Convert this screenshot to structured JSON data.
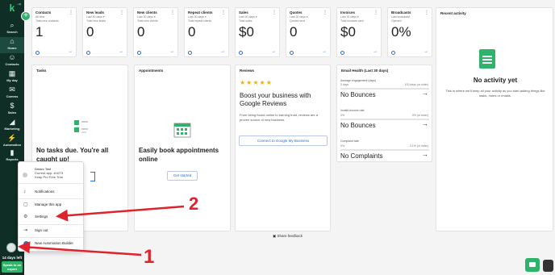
{
  "sidebar": {
    "logo": "k",
    "collapse_icon": "collapse-icon",
    "items": [
      {
        "label": "Search",
        "icon": "⌕"
      },
      {
        "label": "Home",
        "icon": "⌂"
      },
      {
        "label": "Contacts",
        "icon": "☺"
      },
      {
        "label": "My day",
        "icon": "▦"
      },
      {
        "label": "Comms",
        "icon": "✉"
      },
      {
        "label": "Sales",
        "icon": "$"
      },
      {
        "label": "Marketing",
        "icon": "◢"
      },
      {
        "label": "Automation",
        "icon": "⚡"
      },
      {
        "label": "Reports",
        "icon": "▮"
      }
    ],
    "trial_days": "14 days left",
    "expert_btn": "Speak to an expert"
  },
  "stats": [
    {
      "title": "Contacts",
      "sub": "All time",
      "sub2": "Total new contacts",
      "value": "1"
    },
    {
      "title": "New leads",
      "sub": "Last 30 days ▾",
      "sub2": "Total new leads",
      "value": "0"
    },
    {
      "title": "New clients",
      "sub": "Last 30 days ▾",
      "sub2": "Total new clients",
      "value": "0"
    },
    {
      "title": "Repeat clients",
      "sub": "Last 30 days ▾",
      "sub2": "Total repeat clients",
      "value": "0"
    },
    {
      "title": "Sales",
      "sub": "Last 30 days ▾",
      "sub2": "Total sales",
      "value": "$0"
    },
    {
      "title": "Quotes",
      "sub": "Last 30 days ▾",
      "sub2": "Quotes sent",
      "value": "0"
    },
    {
      "title": "Invoices",
      "sub": "Last 30 days ▾",
      "sub2": "Total invoices sent",
      "value": "$0"
    },
    {
      "title": "Broadcasts",
      "sub": "Last broadcast",
      "sub2": "Opened",
      "value": "0%"
    }
  ],
  "recent": {
    "title": "Recent activity",
    "empty": "No activity yet",
    "desc": "This is where we'll keep all your activity as you start adding things like tasks, notes or emails."
  },
  "tasks": {
    "title": "Tasks",
    "heading": "No tasks due. You're all caught up!"
  },
  "appointments": {
    "title": "Appointments",
    "heading": "Easily book appointments online",
    "button": "Get started"
  },
  "reviews": {
    "title": "Reviews",
    "stars": "★★★★★",
    "heading": "Boost your business with Google Reviews",
    "desc": "From being found online to earning trust, reviews are a proven source of new business.",
    "button": "Connect to Google My Business"
  },
  "email_health": {
    "title": "Email Health (Last 30 days)",
    "rows": [
      {
        "label": "Average engagement (days)",
        "left": "0 days",
        "right": "100 days (or older)",
        "status": "No Bounces"
      },
      {
        "label": "Invalid bounce rate",
        "left": "0%",
        "right": "0% (or older)",
        "status": "No Bounces"
      },
      {
        "label": "Complaint rate",
        "left": "0%",
        "right": "0.1% (or older)",
        "status": "No Complaints"
      }
    ]
  },
  "feedback": "Share feedback",
  "popup": {
    "name": "Dmarc Test",
    "app": "Current app: zhl273",
    "trial": "Keap Pro Free Trial",
    "items": [
      {
        "label": "Notifications",
        "icon": "bell-icon",
        "glyph": "♪"
      },
      {
        "label": "Manage this app",
        "icon": "file-icon",
        "glyph": "▢"
      },
      {
        "label": "Settings",
        "icon": "gear-icon",
        "glyph": "⚙"
      },
      {
        "label": "Sign out",
        "icon": "signout-icon",
        "glyph": "⇥"
      },
      {
        "label": "New Automation Builder",
        "icon": "toggle-icon",
        "glyph": ""
      }
    ]
  },
  "annotations": {
    "one": "1",
    "two": "2",
    "color": "#e0222b"
  },
  "colors": {
    "sidebar": "#0f2e26",
    "accent": "#2fb36a",
    "link": "#2a6fd6"
  }
}
